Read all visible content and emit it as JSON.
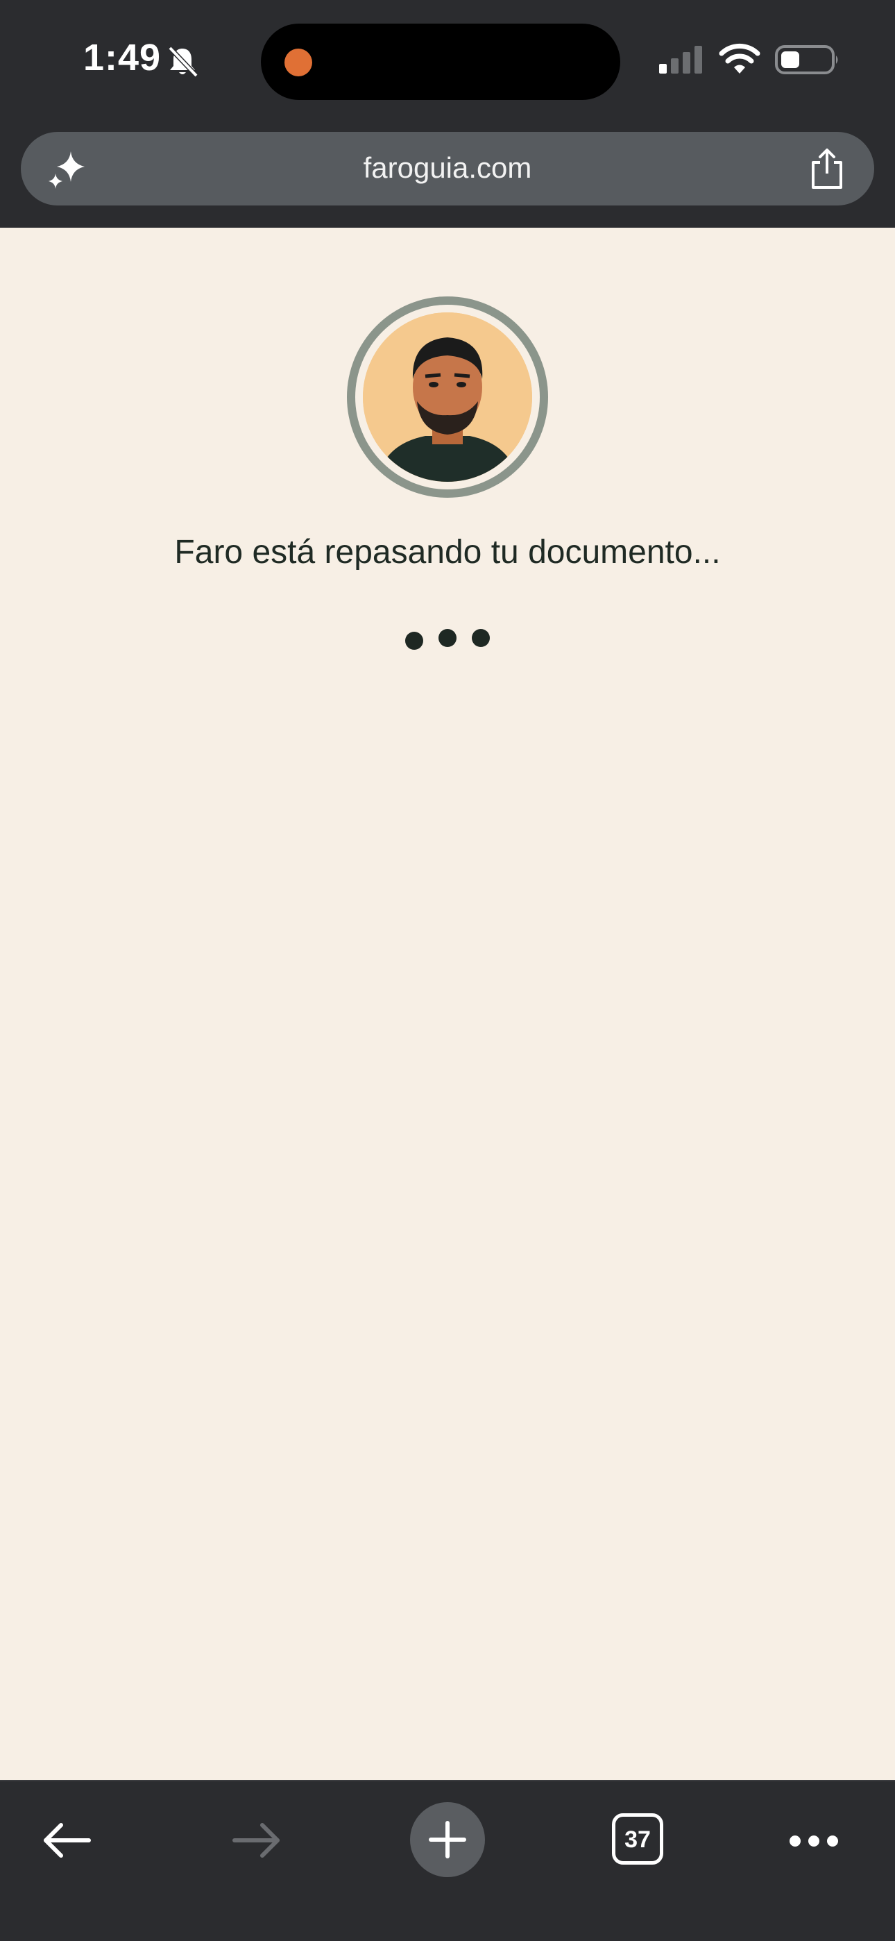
{
  "status_bar": {
    "time": "1:49",
    "bell_icon": "bell-slash-icon",
    "signal_icon": "cellular-signal-icon",
    "wifi_icon": "wifi-icon",
    "battery_icon": "battery-icon",
    "recording_indicator_color": "#e07035"
  },
  "address_bar": {
    "url": "faroguia.com",
    "left_icon": "sparkle-icon",
    "right_icon": "share-icon"
  },
  "main": {
    "avatar": "avatar",
    "loading_text": "Faro está repasando tu documento...",
    "loading_indicator": "typing-dots"
  },
  "toolbar": {
    "back_icon": "back-arrow-icon",
    "forward_icon": "forward-arrow-icon",
    "new_tab_icon": "plus-icon",
    "tabs_count": "37",
    "more_icon": "more-icon"
  },
  "colors": {
    "chrome": "#2b2c2f",
    "page_background": "#f7efe5",
    "text": "#1f2a24",
    "ring": "#8b958b"
  }
}
